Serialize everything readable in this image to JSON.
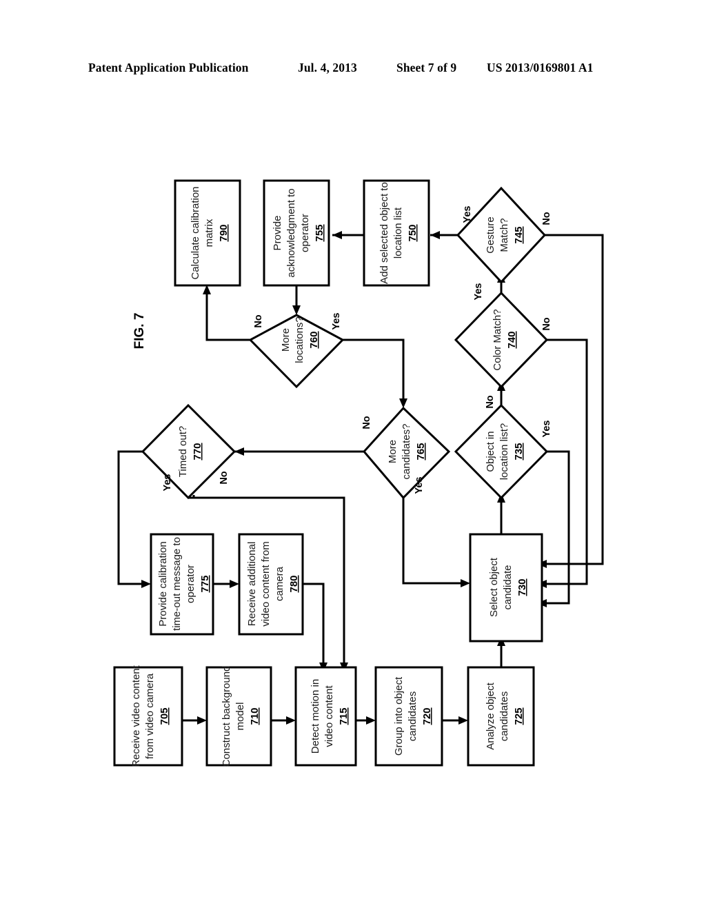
{
  "header": {
    "publication": "Patent Application Publication",
    "date": "Jul. 4, 2013",
    "sheet": "Sheet 7 of 9",
    "patent_number": "US 2013/0169801 A1"
  },
  "figure": {
    "label": "FIG. 7",
    "orientation": "rotated-90-ccw",
    "nodes": [
      {
        "id": "n790",
        "shape": "process",
        "lines": [
          "Calculate calibration",
          "matrix"
        ],
        "ref": "790"
      },
      {
        "id": "n755",
        "shape": "process",
        "lines": [
          "Provide",
          "acknowledgment to",
          "operator"
        ],
        "ref": "755"
      },
      {
        "id": "n750",
        "shape": "process",
        "lines": [
          "Add selected object to",
          "location list"
        ],
        "ref": "750"
      },
      {
        "id": "n745",
        "shape": "decision",
        "lines": [
          "Gesture",
          "Match?"
        ],
        "ref": "745"
      },
      {
        "id": "n760",
        "shape": "decision",
        "lines": [
          "More",
          "locations?"
        ],
        "ref": "760"
      },
      {
        "id": "n740",
        "shape": "decision",
        "lines": [
          "Color Match?"
        ],
        "ref": "740"
      },
      {
        "id": "n770",
        "shape": "decision",
        "lines": [
          "Timed out?"
        ],
        "ref": "770"
      },
      {
        "id": "n765",
        "shape": "decision",
        "lines": [
          "More",
          "candidates?"
        ],
        "ref": "765"
      },
      {
        "id": "n735",
        "shape": "decision",
        "lines": [
          "Object in",
          "location list?"
        ],
        "ref": "735"
      },
      {
        "id": "n775",
        "shape": "process",
        "lines": [
          "Provide calibration",
          "time-out message to",
          "operator"
        ],
        "ref": "775"
      },
      {
        "id": "n780",
        "shape": "process",
        "lines": [
          "Receive additional",
          "video content from",
          "camera"
        ],
        "ref": "780"
      },
      {
        "id": "n730",
        "shape": "process",
        "lines": [
          "Select object",
          "candidate"
        ],
        "ref": "730"
      },
      {
        "id": "n705",
        "shape": "process",
        "lines": [
          "Receive video content",
          "from video camera"
        ],
        "ref": "705"
      },
      {
        "id": "n710",
        "shape": "process",
        "lines": [
          "Construct background",
          "model"
        ],
        "ref": "710"
      },
      {
        "id": "n715",
        "shape": "process",
        "lines": [
          "Detect motion in",
          "video content"
        ],
        "ref": "715"
      },
      {
        "id": "n720",
        "shape": "process",
        "lines": [
          "Group into object",
          "candidates"
        ],
        "ref": "720"
      },
      {
        "id": "n725",
        "shape": "process",
        "lines": [
          "Analyze object",
          "candidates"
        ],
        "ref": "725"
      }
    ],
    "edge_labels": [
      {
        "id": "e745yes",
        "text": "Yes",
        "from": "745",
        "to": "750"
      },
      {
        "id": "e745no",
        "text": "No",
        "from": "745",
        "to": "730"
      },
      {
        "id": "e740yes",
        "text": "Yes",
        "from": "740",
        "to": "745"
      },
      {
        "id": "e740no",
        "text": "No",
        "from": "740",
        "to": "730"
      },
      {
        "id": "e735no",
        "text": "No",
        "from": "735",
        "to": "740"
      },
      {
        "id": "e735yes",
        "text": "Yes",
        "from": "735",
        "to": "730"
      },
      {
        "id": "e760no",
        "text": "No",
        "from": "760",
        "to": "790"
      },
      {
        "id": "e760yes",
        "text": "Yes",
        "from": "760",
        "to": "765"
      },
      {
        "id": "e765no",
        "text": "No",
        "from": "765",
        "to": "770"
      },
      {
        "id": "e765yes",
        "text": "Yes",
        "from": "765",
        "to": "730"
      },
      {
        "id": "e770yes",
        "text": "Yes",
        "from": "770",
        "to": "775"
      },
      {
        "id": "e770no",
        "text": "No",
        "from": "770",
        "to": "715"
      }
    ]
  }
}
